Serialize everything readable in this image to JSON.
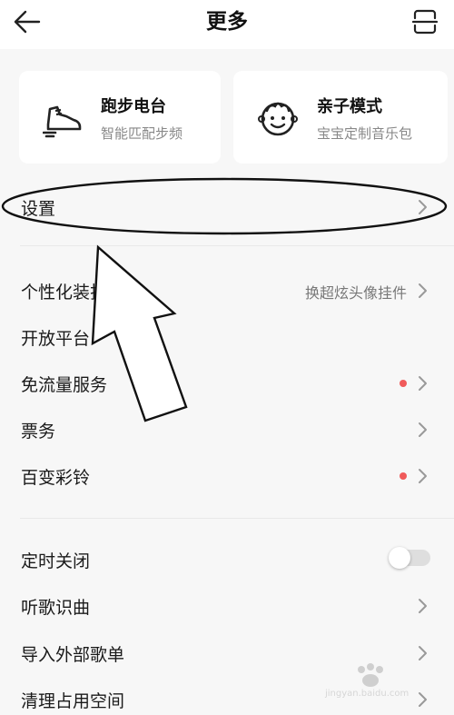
{
  "header": {
    "title": "更多"
  },
  "cards": [
    {
      "title": "跑步电台",
      "subtitle": "智能匹配步频",
      "icon": "running-shoe-icon"
    },
    {
      "title": "亲子模式",
      "subtitle": "宝宝定制音乐包",
      "icon": "baby-face-icon"
    }
  ],
  "settings": {
    "label": "设置"
  },
  "group1": [
    {
      "label": "个性化装扮中心",
      "value": "换超炫头像挂件"
    },
    {
      "label": "开放平台"
    },
    {
      "label": "免流量服务",
      "dot": true
    },
    {
      "label": "票务"
    },
    {
      "label": "百变彩铃",
      "dot": true
    }
  ],
  "group2": [
    {
      "label": "定时关闭",
      "toggle": false
    },
    {
      "label": "听歌识曲"
    },
    {
      "label": "导入外部歌单"
    },
    {
      "label": "清理占用空间"
    }
  ],
  "colors": {
    "accent_dot": "#f05a5a",
    "background": "#f7f7f7",
    "card": "#ffffff"
  },
  "watermark": {
    "text": "jingyan.baidu.com"
  }
}
